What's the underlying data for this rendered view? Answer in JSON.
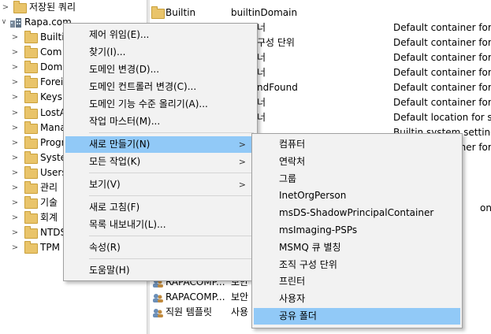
{
  "tree": {
    "saved_queries": "저장된 쿼리",
    "domain": "Rapa.com",
    "children": [
      "Builti",
      "Com",
      "Dom",
      "Forei",
      "Keys",
      "LostA",
      "Mana",
      "Progr",
      "Syste",
      "Users",
      "관리",
      "기술",
      "회계",
      "NTDS",
      "TPM"
    ]
  },
  "list": {
    "rows": [
      {
        "name": "Builtin",
        "type": "builtinDomain",
        "desc": ""
      },
      {
        "name": "",
        "type": "너",
        "desc": "Default container for u"
      },
      {
        "name": "",
        "type": "구성 단위",
        "desc": "Default container for d"
      },
      {
        "name": "",
        "type": "너",
        "desc": "Default container for se"
      },
      {
        "name": "",
        "type": "너",
        "desc": "Default container for ke"
      },
      {
        "name": "",
        "type": "ndFound",
        "desc": "Default container for o"
      },
      {
        "name": "",
        "type": "너",
        "desc": "Default container for m"
      },
      {
        "name": "",
        "type": "너",
        "desc": "Default location for sto"
      },
      {
        "name": "",
        "type": "",
        "desc": "Builtin system settings"
      },
      {
        "name": "",
        "type": "",
        "desc": "Default container for u"
      }
    ],
    "partial_right": "ons co",
    "bottom_rows": [
      {
        "name": "RAPACOMP...",
        "type": "보안"
      },
      {
        "name": "RAPACOMP...",
        "type": "보안"
      },
      {
        "name": "직원 템플릿",
        "type": "사용"
      }
    ]
  },
  "context_menu": {
    "items": [
      {
        "label": "제어 위임(E)...",
        "hl": false,
        "sub": false
      },
      {
        "label": "찾기(I)...",
        "hl": false,
        "sub": false
      },
      {
        "label": "도메인 변경(D)...",
        "hl": false,
        "sub": false
      },
      {
        "label": "도메인 컨트롤러 변경(C)...",
        "hl": false,
        "sub": false
      },
      {
        "label": "도메인 기능 수준 올리기(A)...",
        "hl": false,
        "sub": false
      },
      {
        "label": "작업 마스터(M)...",
        "hl": false,
        "sub": false
      },
      {
        "label": "새로 만들기(N)",
        "hl": true,
        "sub": true
      },
      {
        "label": "모든 작업(K)",
        "hl": false,
        "sub": true
      },
      {
        "label": "보기(V)",
        "hl": false,
        "sub": true
      },
      {
        "label": "새로 고침(F)",
        "hl": false,
        "sub": false
      },
      {
        "label": "목록 내보내기(L)...",
        "hl": false,
        "sub": false
      },
      {
        "label": "속성(R)",
        "hl": false,
        "sub": false
      },
      {
        "label": "도움말(H)",
        "hl": false,
        "sub": false
      }
    ]
  },
  "submenu": {
    "items": [
      "컴퓨터",
      "연락처",
      "그룹",
      "InetOrgPerson",
      "msDS-ShadowPrincipalContainer",
      "msImaging-PSPs",
      "MSMQ 큐 별칭",
      "조직 구성 단위",
      "프린터",
      "사용자",
      "공유 폴더"
    ],
    "highlighted_index": 10
  },
  "colors": {
    "highlight": "#91c9f7",
    "menu_bg": "#f2f2f2",
    "folder": "#e9c46a"
  }
}
